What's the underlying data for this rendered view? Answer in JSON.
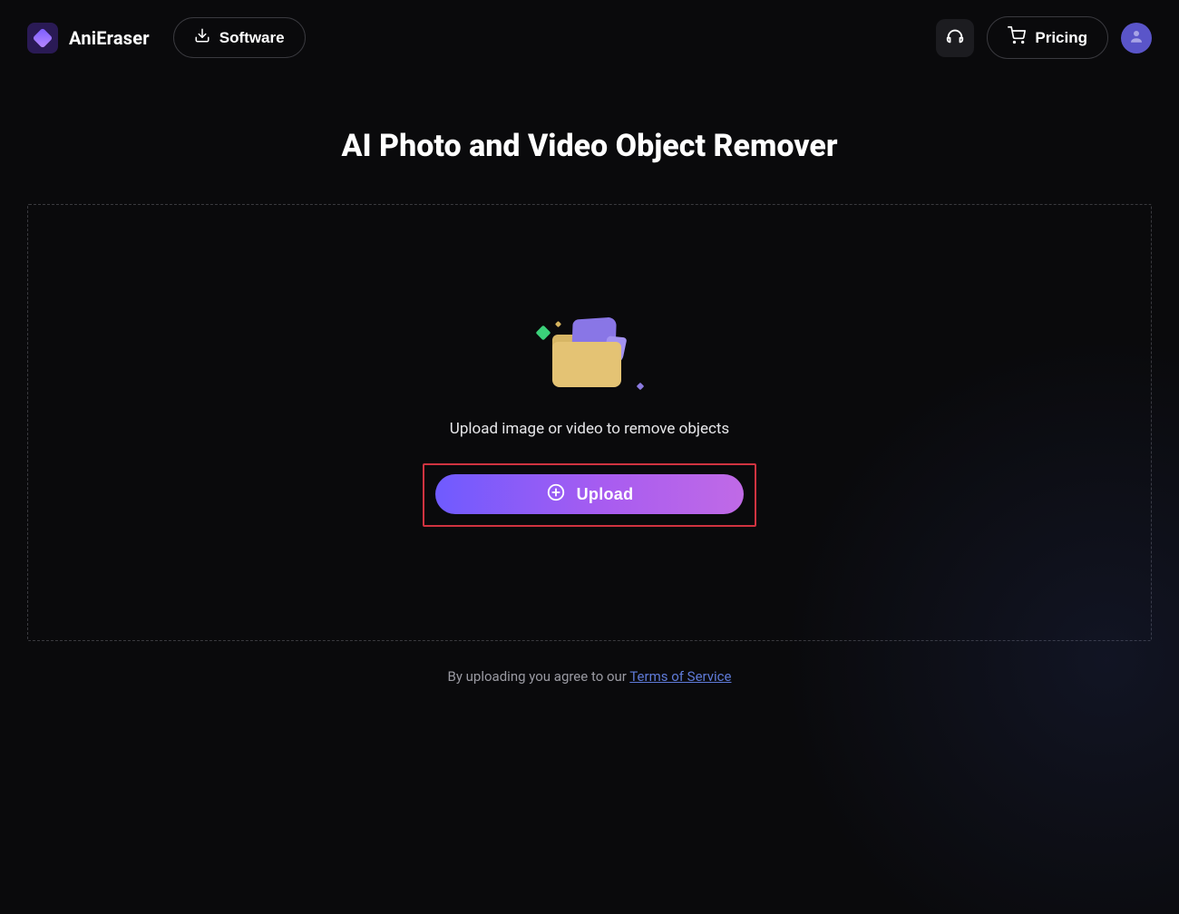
{
  "header": {
    "brand": "AniEraser",
    "software_label": "Software",
    "pricing_label": "Pricing"
  },
  "main": {
    "title": "AI Photo and Video Object Remover",
    "drop_hint": "Upload image or video to remove objects",
    "upload_label": "Upload"
  },
  "footer": {
    "tos_prefix": "By uploading you agree to our ",
    "tos_link": "Terms of Service"
  }
}
